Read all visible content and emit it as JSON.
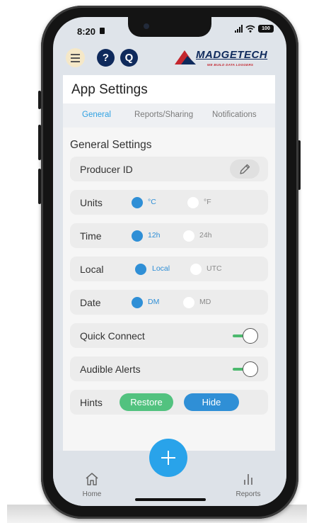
{
  "status": {
    "time": "8:20",
    "battery": "100"
  },
  "header": {
    "help_icon_glyph": "?",
    "q_icon_glyph": "Q",
    "brand": "MADGETECH",
    "brand_tagline": "WE BUILD DATA LOGGERS",
    "brand_color": "#0f2a5c",
    "brand_accent": "#c4262e"
  },
  "page": {
    "title": "App Settings"
  },
  "tabs": [
    {
      "label": "General",
      "active": true
    },
    {
      "label": "Reports/Sharing",
      "active": false
    },
    {
      "label": "Notifications",
      "active": false
    }
  ],
  "section_title": "General Settings",
  "settings": {
    "producer_id": {
      "label": "Producer ID",
      "icon": "pencil-icon"
    },
    "units": {
      "label": "Units",
      "options": [
        "°C",
        "°F"
      ],
      "selected": "°C"
    },
    "time": {
      "label": "Time",
      "options": [
        "12h",
        "24h"
      ],
      "selected": "12h"
    },
    "local": {
      "label": "Local",
      "options": [
        "Local",
        "UTC"
      ],
      "selected": "Local"
    },
    "date": {
      "label": "Date",
      "options": [
        "DM",
        "MD"
      ],
      "selected": "DM"
    },
    "quick_connect": {
      "label": "Quick Connect",
      "enabled": true
    },
    "audible_alerts": {
      "label": "Audible Alerts",
      "enabled": true
    },
    "hints": {
      "label": "Hints",
      "restore_label": "Restore",
      "hide_label": "Hide"
    }
  },
  "bottom_nav": {
    "home_label": "Home",
    "add_icon": "plus-icon",
    "reports_label": "Reports"
  },
  "colors": {
    "accent_blue": "#2f8fd6",
    "tab_active": "#2fa1e2",
    "toggle_green": "#4cb96e",
    "restore_green": "#52c27f",
    "hide_blue": "#2f8fd6",
    "fab_blue": "#29a3ea"
  }
}
